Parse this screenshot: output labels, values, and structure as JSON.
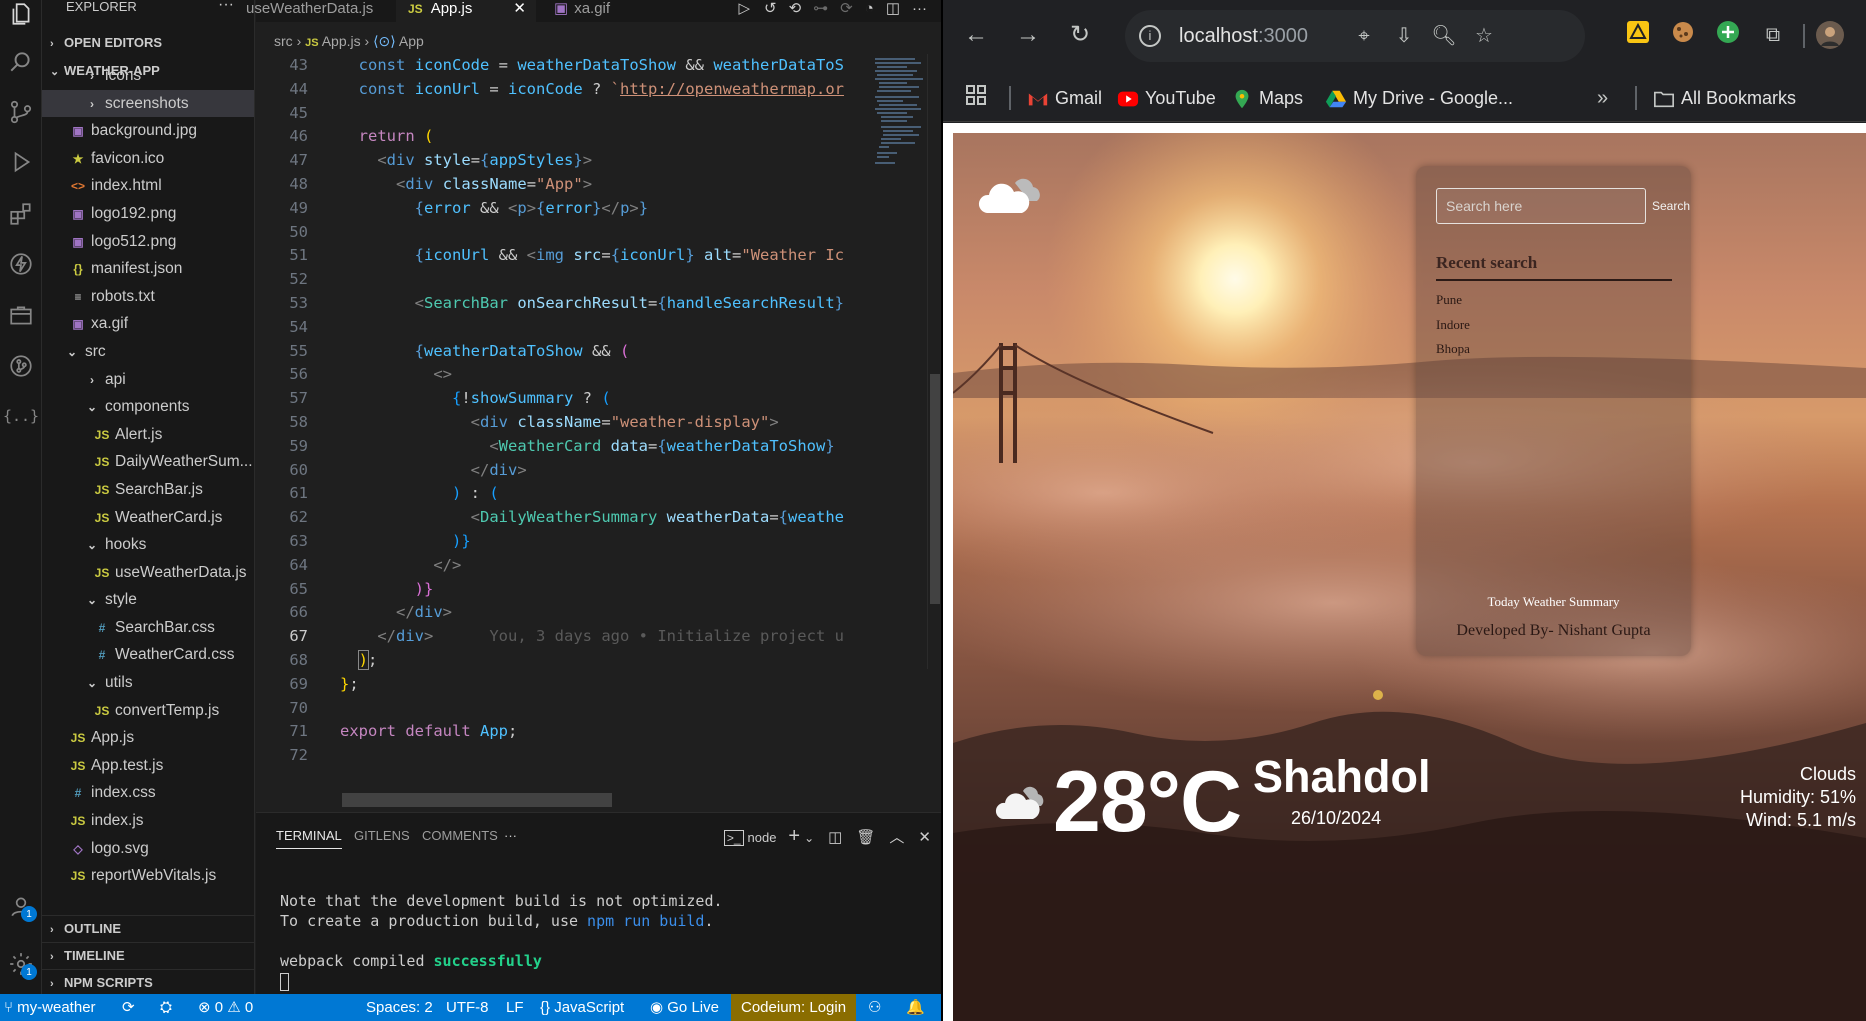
{
  "vscode": {
    "explorer_title": "EXPLORER",
    "sections": {
      "open_editors": "OPEN EDITORS",
      "project": "WEATHER-APP",
      "outline": "OUTLINE",
      "timeline": "TIMELINE",
      "npm_scripts": "NPM SCRIPTS"
    },
    "tree": [
      {
        "label": "icons",
        "type": "folder"
      },
      {
        "label": "screenshots",
        "type": "folder"
      },
      {
        "label": "background.jpg",
        "type": "image"
      },
      {
        "label": "favicon.ico",
        "type": "star"
      },
      {
        "label": "index.html",
        "type": "html"
      },
      {
        "label": "logo192.png",
        "type": "image"
      },
      {
        "label": "logo512.png",
        "type": "image"
      },
      {
        "label": "manifest.json",
        "type": "json"
      },
      {
        "label": "robots.txt",
        "type": "txt"
      },
      {
        "label": "xa.gif",
        "type": "image"
      },
      {
        "label": "src",
        "type": "folder-open"
      },
      {
        "label": "api",
        "type": "folder"
      },
      {
        "label": "components",
        "type": "folder-open"
      },
      {
        "label": "Alert.js",
        "type": "js"
      },
      {
        "label": "DailyWeatherSum...",
        "type": "js"
      },
      {
        "label": "SearchBar.js",
        "type": "js"
      },
      {
        "label": "WeatherCard.js",
        "type": "js"
      },
      {
        "label": "hooks",
        "type": "folder-open"
      },
      {
        "label": "useWeatherData.js",
        "type": "js"
      },
      {
        "label": "style",
        "type": "folder-open"
      },
      {
        "label": "SearchBar.css",
        "type": "css"
      },
      {
        "label": "WeatherCard.css",
        "type": "css"
      },
      {
        "label": "utils",
        "type": "folder-open"
      },
      {
        "label": "convertTemp.js",
        "type": "js"
      },
      {
        "label": "App.js",
        "type": "js"
      },
      {
        "label": "App.test.js",
        "type": "js"
      },
      {
        "label": "index.css",
        "type": "css"
      },
      {
        "label": "index.js",
        "type": "js"
      },
      {
        "label": "logo.svg",
        "type": "svg"
      },
      {
        "label": "reportWebVitals.js",
        "type": "js"
      }
    ],
    "tabs": [
      {
        "label": "useWeatherData.js"
      },
      {
        "label": "App.js",
        "prefix": "JS"
      },
      {
        "label": "xa.gif"
      }
    ],
    "breadcrumb": {
      "folder": "src",
      "file": "App.js",
      "symbol": "App",
      "file_prefix": "JS"
    },
    "code_lines": [
      43,
      44,
      45,
      46,
      47,
      48,
      49,
      50,
      51,
      52,
      53,
      54,
      55,
      56,
      57,
      58,
      59,
      60,
      61,
      62,
      63,
      64,
      65,
      66,
      67,
      68,
      69,
      70,
      71,
      72
    ],
    "current_line": 67,
    "blame": "You, 3 days ago • Initialize project u",
    "panel_tabs": [
      "TERMINAL",
      "GITLENS",
      "COMMENTS"
    ],
    "terminal_shell": "node",
    "terminal": {
      "line1": "Note that the development build is not optimized.",
      "line2_pre": "To create a production build, use ",
      "line2_cmd": "npm run build",
      "line2_post": ".",
      "line3_pre": "webpack compiled ",
      "line3_status": "successfully"
    },
    "status": {
      "branch": "my-weather",
      "errors": "0",
      "warnings": "0",
      "spaces": "Spaces: 2",
      "encoding": "UTF-8",
      "eol": "LF",
      "language": "JavaScript",
      "golive": "Go Live",
      "codeium": "Codeium: Login"
    },
    "badges": {
      "accounts": "1",
      "settings": "1"
    }
  },
  "browser": {
    "url_host": "localhost",
    "url_port": ":3000",
    "bookmarks": [
      "Gmail",
      "YouTube",
      "Maps",
      "My Drive - Google...",
      "All Bookmarks"
    ],
    "app": {
      "search_placeholder": "Search here",
      "search_button": "Search",
      "recent_title": "Recent search",
      "recent_items": [
        "Pune",
        "Indore",
        "Bhopa"
      ],
      "today_summary": "Today Weather Summary",
      "developer": "Developed By- Nishant Gupta",
      "temperature": "28°C",
      "city": "Shahdol",
      "date": "26/10/2024",
      "condition": "Clouds",
      "humidity": "Humidity: 51%",
      "wind": "Wind: 5.1 m/s"
    }
  }
}
